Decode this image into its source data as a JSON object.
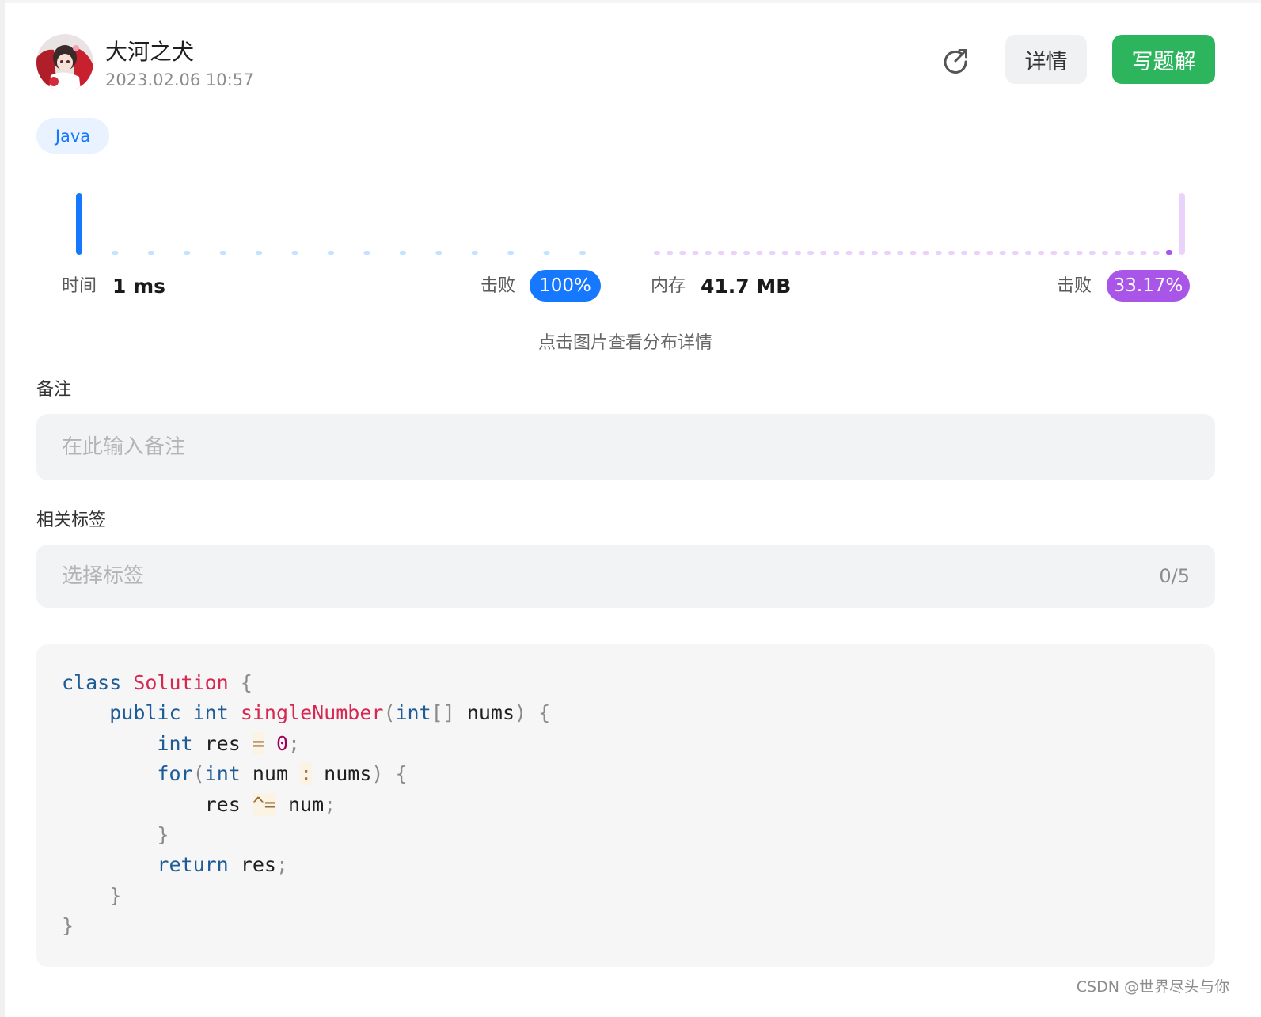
{
  "header": {
    "user_name": "大河之犬",
    "date": "2023.02.06 10:57",
    "details_label": "详情",
    "write_label": "写题解",
    "share_icon": "share-icon",
    "accent_green": "#2db55d"
  },
  "language": "Java",
  "stats": {
    "time_label": "时间",
    "time_value": "1 ms",
    "time_beat_label": "击败",
    "time_beat_pct": "100%",
    "time_color": "#1677ff",
    "memory_label": "内存",
    "memory_value": "41.7 MB",
    "memory_beat_label": "击败",
    "memory_beat_pct": "33.17%",
    "memory_color": "#a855e8",
    "hint": "点击图片查看分布详情"
  },
  "chart_data": [
    {
      "type": "bar",
      "title": "",
      "series": [
        {
          "values": [
            100,
            0,
            0,
            0,
            0,
            0,
            0,
            0,
            0,
            0,
            0,
            0,
            0,
            0,
            0
          ]
        }
      ],
      "highlight_index": 0,
      "grid": false
    },
    {
      "type": "bar",
      "title": "",
      "series": [
        {
          "values": [
            0,
            0,
            0,
            0,
            0,
            0,
            0,
            0,
            0,
            0,
            0,
            0,
            0,
            0,
            0,
            0,
            0,
            0,
            0,
            0,
            0,
            0,
            0,
            0,
            0,
            0,
            0,
            0,
            0,
            0,
            0,
            0,
            0,
            0,
            0,
            0,
            0,
            0,
            0,
            0,
            2,
            100
          ]
        }
      ],
      "highlight_index": 40,
      "grid": false
    }
  ],
  "note": {
    "label": "备注",
    "placeholder": "在此输入备注"
  },
  "tags": {
    "label": "相关标签",
    "placeholder": "选择标签",
    "count": "0/5"
  },
  "code": {
    "lines": [
      [
        [
          "kw",
          "class"
        ],
        [
          "t",
          " "
        ],
        [
          "cls",
          "Solution"
        ],
        [
          "t",
          " "
        ],
        [
          "pun",
          "{"
        ]
      ],
      [
        [
          "t",
          "    "
        ],
        [
          "kw",
          "public"
        ],
        [
          "t",
          " "
        ],
        [
          "kw",
          "int"
        ],
        [
          "t",
          " "
        ],
        [
          "cls",
          "singleNumber"
        ],
        [
          "pun",
          "("
        ],
        [
          "kw",
          "int"
        ],
        [
          "pun",
          "[]"
        ],
        [
          "t",
          " nums"
        ],
        [
          "pun",
          ")"
        ],
        [
          "t",
          " "
        ],
        [
          "pun",
          "{"
        ]
      ],
      [
        [
          "t",
          "        "
        ],
        [
          "kw",
          "int"
        ],
        [
          "t",
          " res "
        ],
        [
          "op",
          "="
        ],
        [
          "t",
          " "
        ],
        [
          "num",
          "0"
        ],
        [
          "pun",
          ";"
        ]
      ],
      [
        [
          "t",
          "        "
        ],
        [
          "kw",
          "for"
        ],
        [
          "pun",
          "("
        ],
        [
          "kw",
          "int"
        ],
        [
          "t",
          " num "
        ],
        [
          "op",
          ":"
        ],
        [
          "t",
          " nums"
        ],
        [
          "pun",
          ")"
        ],
        [
          "t",
          " "
        ],
        [
          "pun",
          "{"
        ]
      ],
      [
        [
          "t",
          "            res "
        ],
        [
          "op",
          "^="
        ],
        [
          "t",
          " num"
        ],
        [
          "pun",
          ";"
        ]
      ],
      [
        [
          "t",
          "        "
        ],
        [
          "pun",
          "}"
        ]
      ],
      [
        [
          "t",
          "        "
        ],
        [
          "kw",
          "return"
        ],
        [
          "t",
          " res"
        ],
        [
          "pun",
          ";"
        ]
      ],
      [
        [
          "t",
          "    "
        ],
        [
          "pun",
          "}"
        ]
      ],
      [
        [
          "pun",
          "}"
        ]
      ]
    ]
  },
  "watermark": "CSDN @世界尽头与你"
}
